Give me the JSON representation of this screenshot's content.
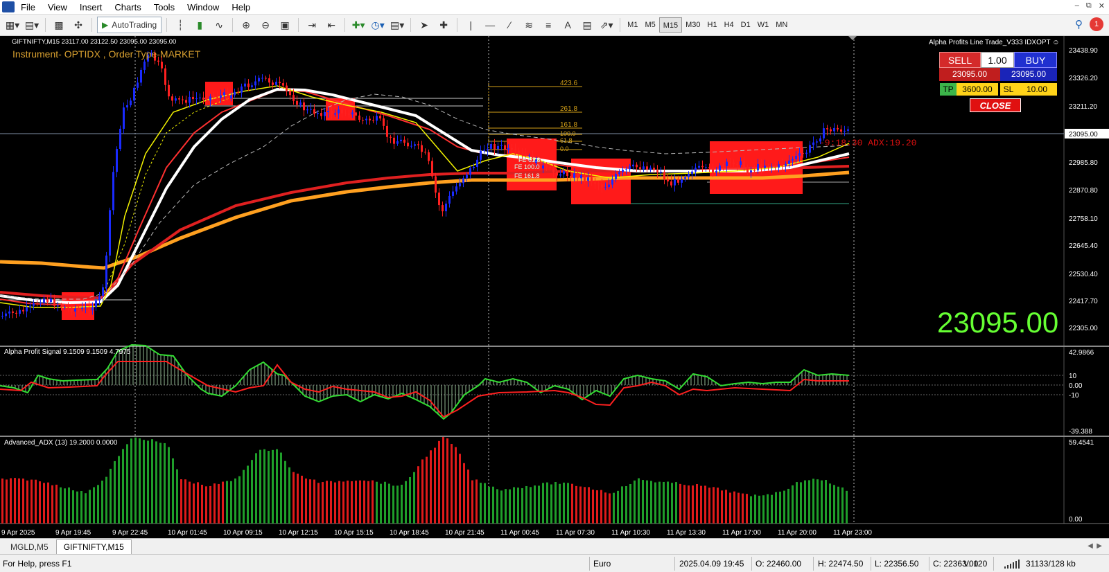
{
  "menu": [
    "File",
    "View",
    "Insert",
    "Charts",
    "Tools",
    "Window",
    "Help"
  ],
  "toolbar": {
    "autotrading_label": "AutoTrading",
    "timeframes": [
      "M1",
      "M5",
      "M15",
      "M30",
      "H1",
      "H4",
      "D1",
      "W1",
      "MN"
    ],
    "active_timeframe": "M15",
    "notification_count": "1"
  },
  "chart": {
    "symbol_line": "GIFTNIFTY,M15  23117.00 23122.50 23095.00 23095.00",
    "instrument_line": "Instrument- OPTIDX , Order Type-MARKET",
    "current_price_label": "23095.00",
    "adx_timer_text": "-9:18:30 ADX:19.20",
    "price_axis_labels": [
      "23438.90",
      "23326.20",
      "23211.20",
      "23095.00",
      "22985.80",
      "22870.80",
      "22758.10",
      "22645.40",
      "22530.40",
      "22417.70",
      "22305.00"
    ],
    "fib_levels": [
      "423.6",
      "261.8",
      "161.8",
      "100.0",
      "61.8",
      "0.0"
    ],
    "fe_levels": [
      "FE 61.8",
      "FE 100.0",
      "FE 161.8"
    ],
    "time_axis_labels": [
      "9 Apr 2025",
      "9 Apr 19:45",
      "9 Apr 22:45",
      "10 Apr 01:45",
      "10 Apr 09:15",
      "10 Apr 12:15",
      "10 Apr 15:15",
      "10 Apr 18:45",
      "10 Apr 21:45",
      "11 Apr 00:45",
      "11 Apr 07:30",
      "11 Apr 10:30",
      "11 Apr 13:30",
      "11 Apr 17:00",
      "11 Apr 20:00",
      "11 Apr 23:00"
    ]
  },
  "trade_panel": {
    "title": "Alpha Profits Line Trade_V333 IDXOPT",
    "sell_label": "SELL",
    "buy_label": "BUY",
    "lot": "1.00",
    "sell_price": "23095.00",
    "buy_price": "23095.00",
    "tp_label": "TP",
    "tp_value": "3600.00",
    "sl_label": "SL",
    "sl_value": "10.00",
    "close_label": "CLOSE"
  },
  "signal_panel": {
    "title": "Alpha Profit Signal 9.1509 9.1509 4.7975",
    "axis_labels": [
      "42.9866",
      "10",
      "0.00",
      "-10",
      "-39.388"
    ]
  },
  "adx_panel": {
    "title": "Advanced_ADX (13) 19.2000 0.0000",
    "axis_labels": [
      "59.4541",
      "0.00"
    ]
  },
  "tabs": [
    "MGLD,M5",
    "GIFTNIFTY,M15"
  ],
  "active_tab": "GIFTNIFTY,M15",
  "status": {
    "help": "For Help, press F1",
    "profile": "Euro",
    "datetime": "2025.04.09 19:45",
    "open": "O: 22460.00",
    "high": "H: 22474.50",
    "low": "L: 22356.50",
    "close": "C: 22363.00",
    "volume": "V: 120",
    "traffic": "31133/128 kb"
  },
  "colors": {
    "bull_candle": "#1a2bff",
    "bear_candle": "#ff2020",
    "signal_green": "#33dd33",
    "signal_red": "#ff2020",
    "ma_white": "#ffffff",
    "ma_yellow": "#f2f200",
    "ma_orange": "#ffa020",
    "big_price": "#66ff33"
  }
}
